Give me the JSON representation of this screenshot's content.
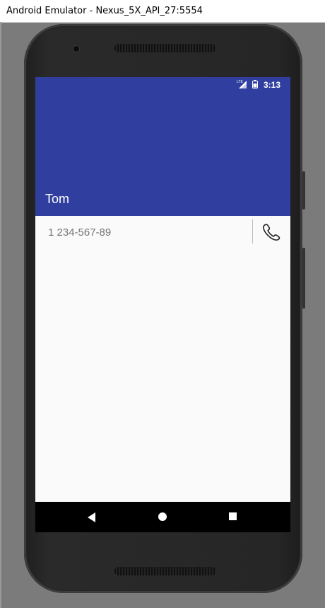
{
  "window": {
    "title": "Android Emulator - Nexus_5X_API_27:5554"
  },
  "statusbar": {
    "time": "3:13",
    "network_label": "LTE",
    "icons": [
      "lte-signal-icon",
      "battery-icon"
    ]
  },
  "appbar": {
    "title": "Tom",
    "color": "#303f9f"
  },
  "contact": {
    "phone_number": "1 234-567-89",
    "call_icon": "phone-icon"
  },
  "navbar": {
    "icons": [
      "back-icon",
      "home-icon",
      "recents-icon"
    ]
  }
}
